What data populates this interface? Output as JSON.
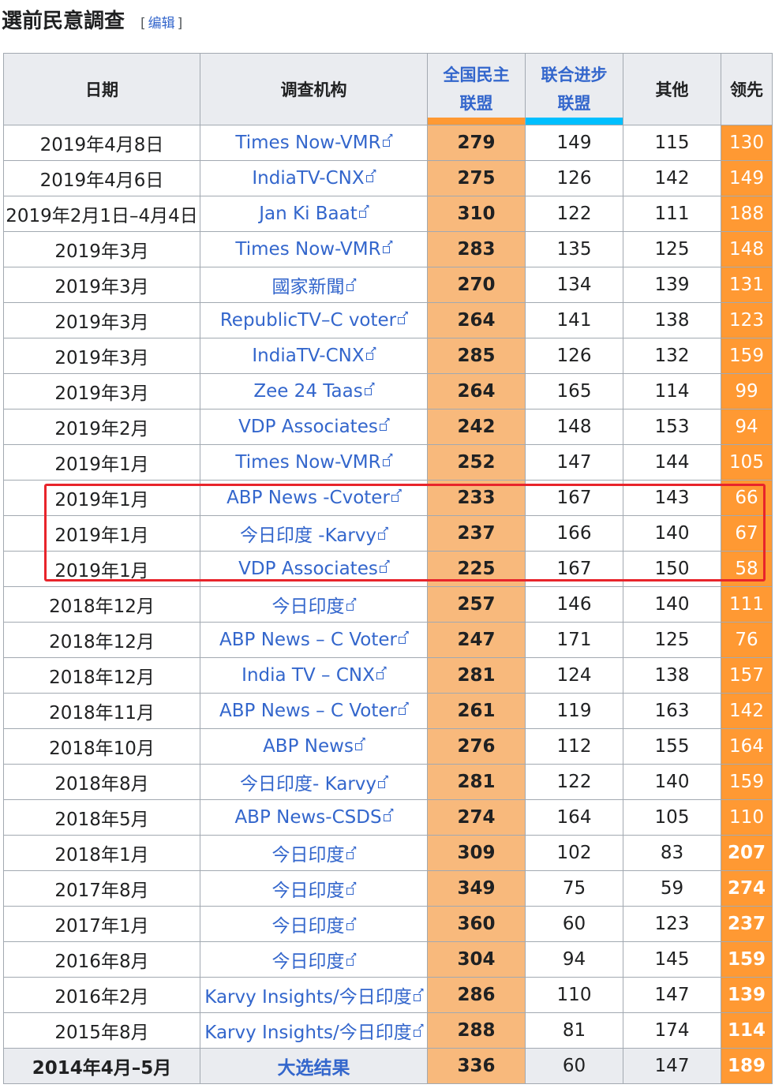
{
  "section": {
    "title": "選前民意調查",
    "edit_label": "编辑",
    "bracket_open": "[",
    "bracket_close": "]"
  },
  "table": {
    "headers": {
      "date": "日期",
      "agency": "调查机构",
      "nda_line1": "全国民主",
      "nda_line2": "联盟",
      "upa_line1": "联合进步",
      "upa_line2": "联盟",
      "others": "其他",
      "lead": "领先"
    },
    "colors": {
      "nda": "#ff9933",
      "nda_cell": "#f8b97c",
      "upa": "#00bfff",
      "others_header": "#2ca02c",
      "highlight": "#e8242b"
    },
    "rows": [
      {
        "date": "2019年4月8日",
        "agency": "Times Now-VMR",
        "nda": "279",
        "upa": "149",
        "others": "115",
        "lead": "130",
        "lead_bold": false
      },
      {
        "date": "2019年4月6日",
        "agency": "IndiaTV-CNX",
        "nda": "275",
        "upa": "126",
        "others": "142",
        "lead": "149",
        "lead_bold": false
      },
      {
        "date": "2019年2月1日–4月4日",
        "agency": "Jan Ki Baat",
        "nda": "310",
        "upa": "122",
        "others": "111",
        "lead": "188",
        "lead_bold": false
      },
      {
        "date": "2019年3月",
        "agency": "Times Now-VMR",
        "nda": "283",
        "upa": "135",
        "others": "125",
        "lead": "148",
        "lead_bold": false
      },
      {
        "date": "2019年3月",
        "agency": "國家新聞",
        "nda": "270",
        "upa": "134",
        "others": "139",
        "lead": "131",
        "lead_bold": false
      },
      {
        "date": "2019年3月",
        "agency": "RepublicTV–C voter",
        "nda": "264",
        "upa": "141",
        "others": "138",
        "lead": "123",
        "lead_bold": false
      },
      {
        "date": "2019年3月",
        "agency": "IndiaTV-CNX",
        "nda": "285",
        "upa": "126",
        "others": "132",
        "lead": "159",
        "lead_bold": false
      },
      {
        "date": "2019年3月",
        "agency": "Zee 24 Taas",
        "nda": "264",
        "upa": "165",
        "others": "114",
        "lead": "99",
        "lead_bold": false
      },
      {
        "date": "2019年2月",
        "agency": "VDP Associates",
        "nda": "242",
        "upa": "148",
        "others": "153",
        "lead": "94",
        "lead_bold": false
      },
      {
        "date": "2019年1月",
        "agency": "Times Now-VMR",
        "nda": "252",
        "upa": "147",
        "others": "144",
        "lead": "105",
        "lead_bold": false
      },
      {
        "date": "2019年1月",
        "agency": "ABP News -Cvoter",
        "nda": "233",
        "upa": "167",
        "others": "143",
        "lead": "66",
        "lead_bold": false
      },
      {
        "date": "2019年1月",
        "agency": "今日印度 -Karvy",
        "nda": "237",
        "upa": "166",
        "others": "140",
        "lead": "67",
        "lead_bold": false
      },
      {
        "date": "2019年1月",
        "agency": "VDP Associates",
        "nda": "225",
        "upa": "167",
        "others": "150",
        "lead": "58",
        "lead_bold": false
      },
      {
        "date": "2018年12月",
        "agency": "今日印度",
        "nda": "257",
        "upa": "146",
        "others": "140",
        "lead": "111",
        "lead_bold": false
      },
      {
        "date": "2018年12月",
        "agency": "ABP News – C Voter",
        "nda": "247",
        "upa": "171",
        "others": "125",
        "lead": "76",
        "lead_bold": false
      },
      {
        "date": "2018年12月",
        "agency": "India TV – CNX",
        "nda": "281",
        "upa": "124",
        "others": "138",
        "lead": "157",
        "lead_bold": false
      },
      {
        "date": "2018年11月",
        "agency": "ABP News – C Voter",
        "nda": "261",
        "upa": "119",
        "others": "163",
        "lead": "142",
        "lead_bold": false
      },
      {
        "date": "2018年10月",
        "agency": "ABP News",
        "nda": "276",
        "upa": "112",
        "others": "155",
        "lead": "164",
        "lead_bold": false
      },
      {
        "date": "2018年8月",
        "agency": "今日印度- Karvy",
        "nda": "281",
        "upa": "122",
        "others": "140",
        "lead": "159",
        "lead_bold": false
      },
      {
        "date": "2018年5月",
        "agency": "ABP News-CSDS",
        "nda": "274",
        "upa": "164",
        "others": "105",
        "lead": "110",
        "lead_bold": false
      },
      {
        "date": "2018年1月",
        "agency": "今日印度",
        "nda": "309",
        "upa": "102",
        "others": "83",
        "lead": "207",
        "lead_bold": true
      },
      {
        "date": "2017年8月",
        "agency": "今日印度",
        "nda": "349",
        "upa": "75",
        "others": "59",
        "lead": "274",
        "lead_bold": true
      },
      {
        "date": "2017年1月",
        "agency": "今日印度",
        "nda": "360",
        "upa": "60",
        "others": "123",
        "lead": "237",
        "lead_bold": true
      },
      {
        "date": "2016年8月",
        "agency": "今日印度",
        "nda": "304",
        "upa": "94",
        "others": "145",
        "lead": "159",
        "lead_bold": true
      },
      {
        "date": "2016年2月",
        "agency": "Karvy Insights/今日印度",
        "nda": "286",
        "upa": "110",
        "others": "147",
        "lead": "139",
        "lead_bold": true
      },
      {
        "date": "2015年8月",
        "agency": "Karvy Insights/今日印度",
        "nda": "288",
        "upa": "81",
        "others": "174",
        "lead": "114",
        "lead_bold": true
      }
    ],
    "final_row": {
      "date": "2014年4月–5月",
      "agency": "大选结果",
      "nda": "336",
      "upa": "60",
      "others": "147",
      "lead": "189"
    }
  }
}
